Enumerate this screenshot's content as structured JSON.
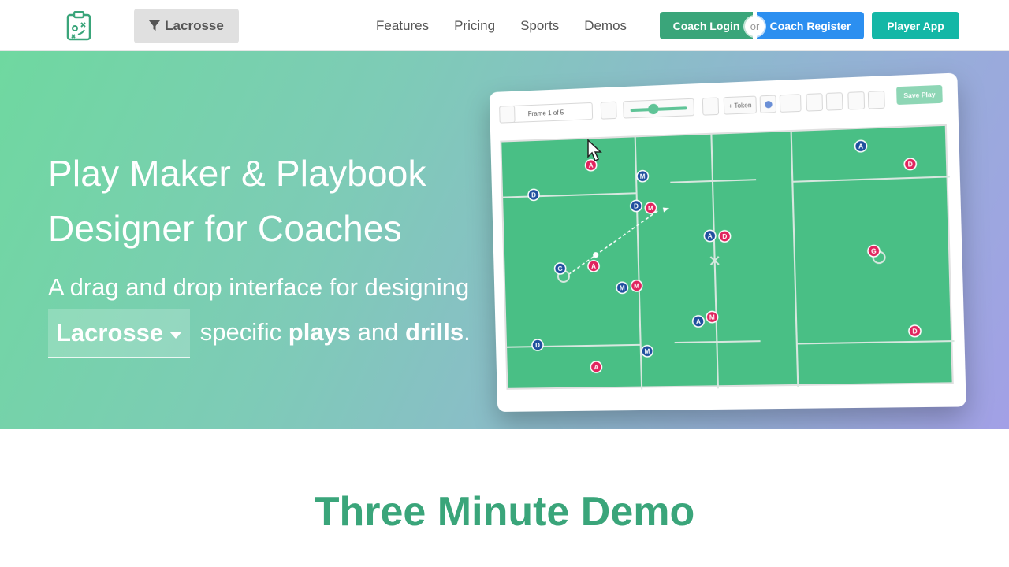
{
  "header": {
    "sport_filter": "Lacrosse",
    "nav": [
      "Features",
      "Pricing",
      "Sports",
      "Demos"
    ],
    "coach_login": "Coach Login",
    "or": "or",
    "coach_register": "Coach Register",
    "player_app": "Player App"
  },
  "hero": {
    "title_line1": "Play Maker & Playbook",
    "title_line2": "Designer for Coaches",
    "subtitle_prefix": "A drag and drop interface for designing",
    "sport": "Lacrosse",
    "subtitle_mid1": "specific",
    "plays": "plays",
    "subtitle_mid2": "and",
    "drills": "drills",
    "subtitle_end": "."
  },
  "mockup": {
    "frame_label": "Frame 1 of 5",
    "token_button": "+ Token",
    "save_play": "Save Play",
    "tokens": [
      {
        "label": "A",
        "team": "red"
      },
      {
        "label": "M",
        "team": "blue"
      },
      {
        "label": "D",
        "team": "blue"
      },
      {
        "label": "D",
        "team": "blue"
      },
      {
        "label": "M",
        "team": "red"
      },
      {
        "label": "A",
        "team": "blue"
      },
      {
        "label": "D",
        "team": "red"
      },
      {
        "label": "G",
        "team": "blue"
      },
      {
        "label": "A",
        "team": "red"
      },
      {
        "label": "M",
        "team": "blue"
      },
      {
        "label": "M",
        "team": "red"
      },
      {
        "label": "A",
        "team": "blue"
      },
      {
        "label": "M",
        "team": "red"
      },
      {
        "label": "D",
        "team": "blue"
      },
      {
        "label": "M",
        "team": "blue"
      },
      {
        "label": "A",
        "team": "red"
      },
      {
        "label": "A",
        "team": "blue"
      },
      {
        "label": "D",
        "team": "red"
      },
      {
        "label": "G",
        "team": "red"
      },
      {
        "label": "D",
        "team": "red"
      }
    ],
    "colors": {
      "red": "#e0245e",
      "blue": "#1f4f9e",
      "field": "#49bf85"
    }
  },
  "demo": {
    "heading": "Three Minute Demo"
  }
}
